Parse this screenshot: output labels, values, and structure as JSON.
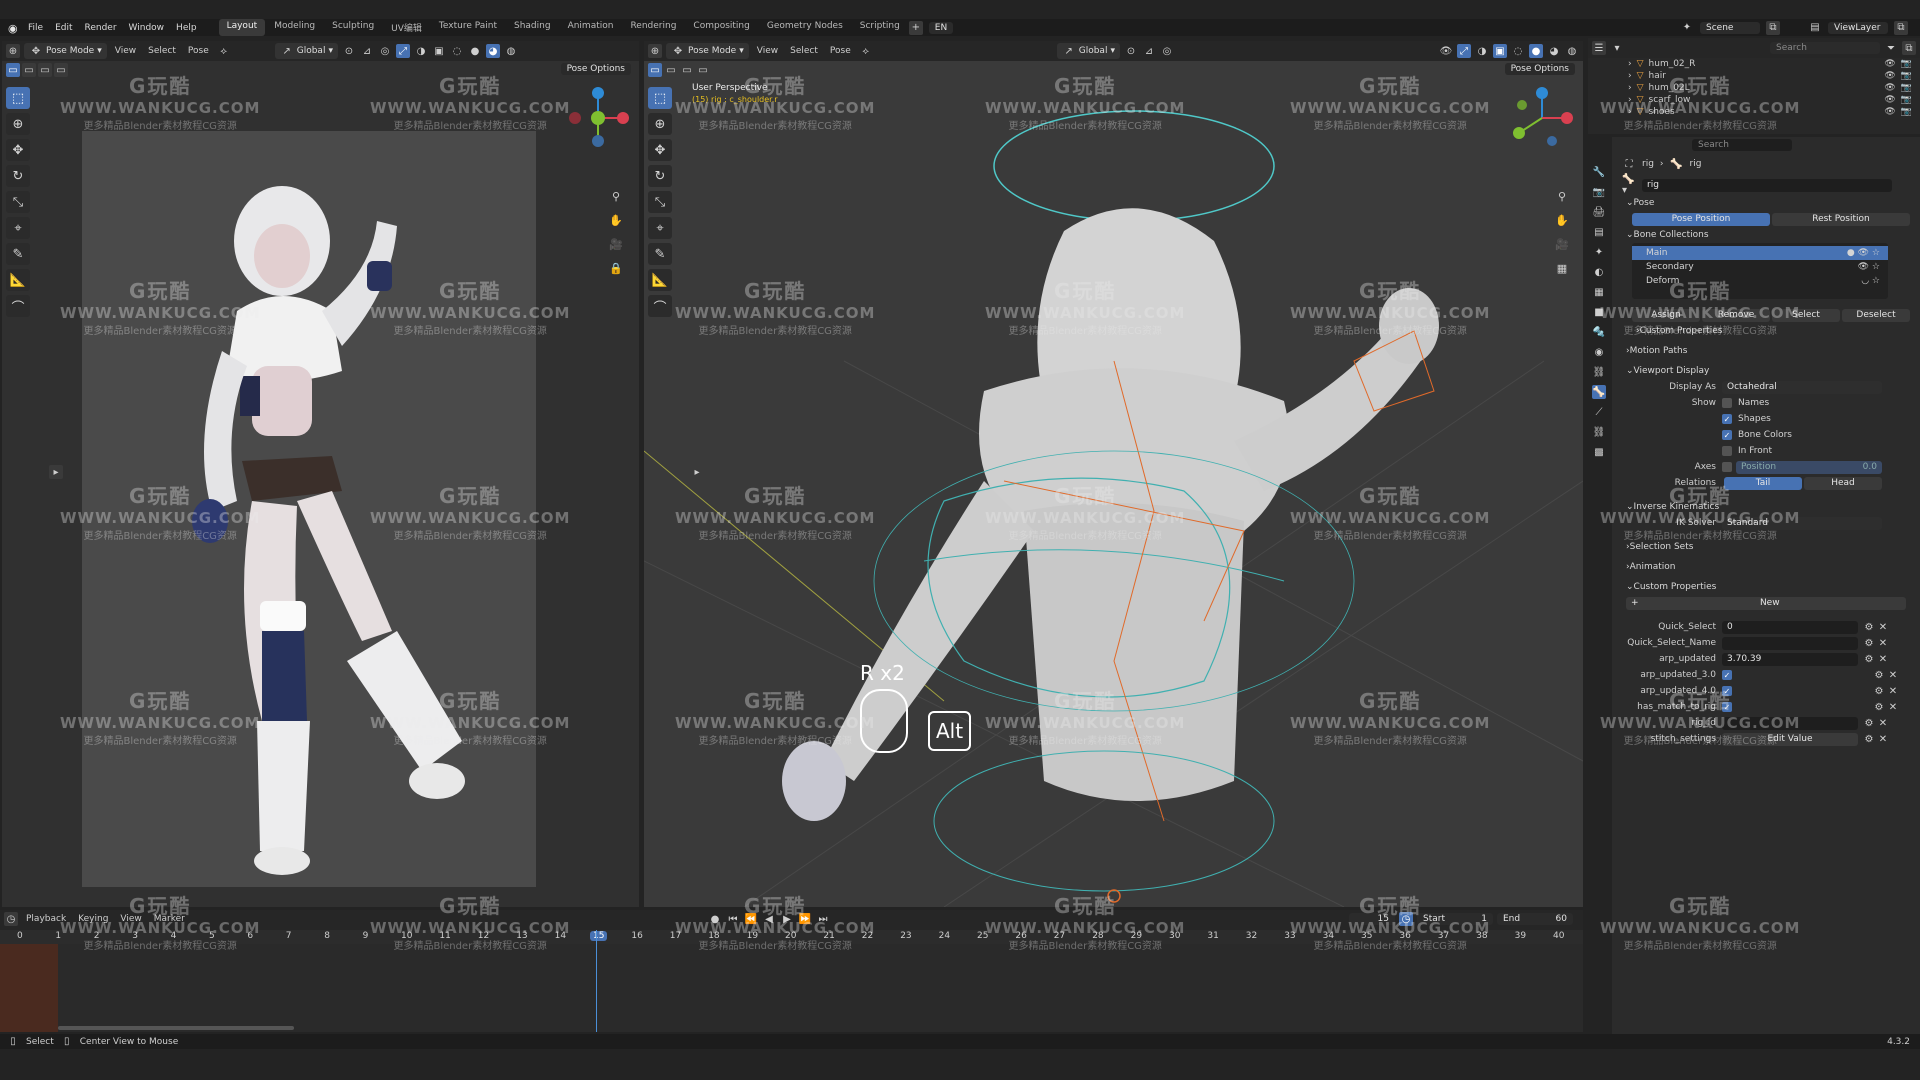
{
  "topbar": {
    "menus": [
      "File",
      "Edit",
      "Render",
      "Window",
      "Help"
    ],
    "workspaces": [
      "Layout",
      "Modeling",
      "Sculpting",
      "UV编辑",
      "Texture Paint",
      "Shading",
      "Animation",
      "Rendering",
      "Compositing",
      "Geometry Nodes",
      "Scripting"
    ],
    "active_workspace": "Layout",
    "lang": "EN",
    "scene_label": "Scene",
    "viewlayer_label": "ViewLayer"
  },
  "left_view": {
    "mode": "Pose Mode",
    "menus": [
      "View",
      "Select",
      "Pose"
    ],
    "orientation": "Global",
    "pose_options": "Pose Options"
  },
  "main_view": {
    "mode": "Pose Mode",
    "menus": [
      "View",
      "Select",
      "Pose"
    ],
    "orientation": "Global",
    "pose_options": "Pose Options",
    "overlay_title": "User Perspective",
    "overlay_subtitle": "(15) rig : c_shoulder.r",
    "key_hint": "R x2",
    "alt_key": "Alt"
  },
  "outliner": {
    "search_placeholder": "Search",
    "items": [
      "hum_02_R",
      "hair",
      "hum_02L",
      "scarf_low",
      "shoes"
    ]
  },
  "properties": {
    "search_placeholder": "Search",
    "breadcrumb": [
      "rig",
      "rig"
    ],
    "name_field": "rig",
    "pose_section": "Pose",
    "pose_position": "Pose Position",
    "rest_position": "Rest Position",
    "bone_collections": "Bone Collections",
    "collections": [
      "Main",
      "Secondary",
      "Deform"
    ],
    "assign": "Assign",
    "remove": "Remove",
    "select": "Select",
    "deselect": "Deselect",
    "custom_props_sub": "Custom Properties",
    "motion_paths": "Motion Paths",
    "viewport_display": "Viewport Display",
    "display_as_label": "Display As",
    "display_as": "Octahedral",
    "show_label": "Show",
    "show_names": "Names",
    "show_shapes": "Shapes",
    "show_bone_colors": "Bone Colors",
    "show_in_front": "In Front",
    "axes_label": "Axes",
    "axes_value": "Position",
    "axes_num": "0.0",
    "relations_label": "Relations",
    "tail": "Tail",
    "head": "Head",
    "ik": "Inverse Kinematics",
    "ik_solver_label": "IK Solver",
    "ik_solver": "Standard",
    "selection_sets": "Selection Sets",
    "animation": "Animation",
    "custom_properties": "Custom Properties",
    "new": "New",
    "custom": [
      {
        "k": "Quick_Select",
        "v": "0",
        "type": "text"
      },
      {
        "k": "Quick_Select_Name",
        "v": "",
        "type": "text"
      },
      {
        "k": "arp_updated",
        "v": "3.70.39",
        "type": "text"
      },
      {
        "k": "arp_updated_3.0",
        "v": "",
        "type": "check"
      },
      {
        "k": "arp_updated_4.0",
        "v": "",
        "type": "check"
      },
      {
        "k": "has_match_to_rig",
        "v": "",
        "type": "check"
      },
      {
        "k": "rig_id",
        "v": "",
        "type": "text"
      },
      {
        "k": "stitch_settings",
        "v": "Edit Value",
        "type": "button"
      }
    ]
  },
  "timeline": {
    "menus": [
      "Playback",
      "Keying",
      "View",
      "Marker"
    ],
    "frames": [
      "0",
      "1",
      "2",
      "3",
      "4",
      "5",
      "6",
      "7",
      "8",
      "9",
      "10",
      "11",
      "12",
      "13",
      "14",
      "15",
      "16",
      "17",
      "18",
      "19",
      "20",
      "21",
      "22",
      "23",
      "24",
      "25",
      "26",
      "27",
      "28",
      "29",
      "30",
      "31",
      "32",
      "33",
      "34",
      "35",
      "36",
      "37",
      "38",
      "39",
      "40"
    ],
    "current_frame": "15",
    "current_display": "15",
    "start_label": "Start",
    "start": "1",
    "end_label": "End",
    "end": "60"
  },
  "status": {
    "select": "Select",
    "center": "Center View to Mouse",
    "version": "4.3.2"
  },
  "watermark": {
    "a": "G玩酷",
    "b": "WWW.WANKUCG.COM",
    "c": "更多精品Blender素材教程CG资源"
  }
}
